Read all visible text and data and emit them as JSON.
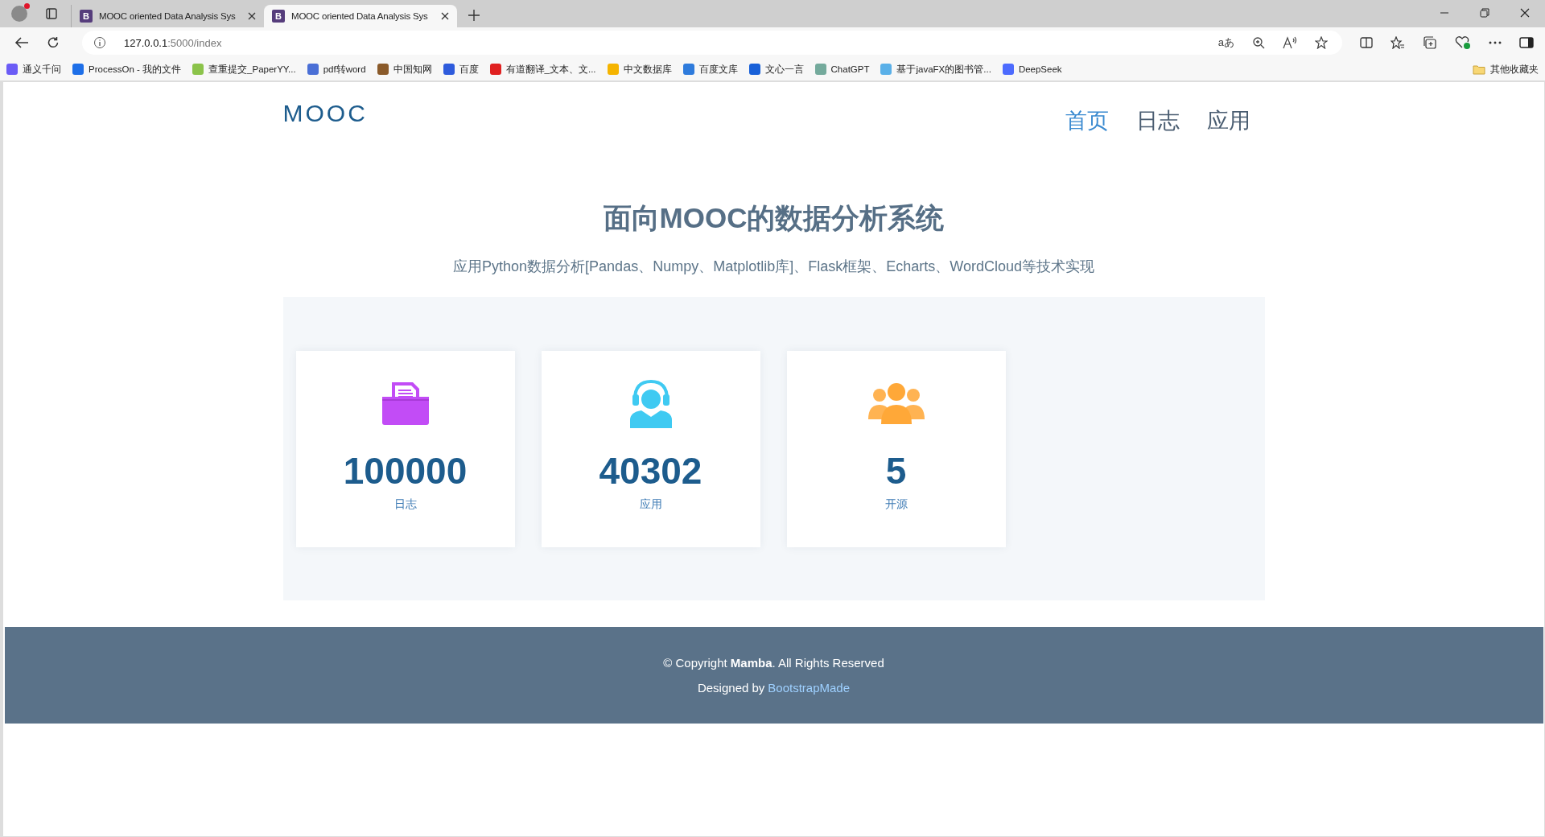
{
  "browser": {
    "tabs": [
      {
        "title": "MOOC oriented Data Analysis Sys",
        "icon_letter": "B",
        "selected": false
      },
      {
        "title": "MOOC oriented Data Analysis Sys",
        "icon_letter": "B",
        "selected": true
      }
    ],
    "address": {
      "host": "127.0.0.1",
      "rest": ":5000/index"
    },
    "translate_glyph": "aあ",
    "bookmarks": [
      {
        "label": "通义千问",
        "color": "#6b5cf6"
      },
      {
        "label": "ProcessOn - 我的文件",
        "color": "#1e6fe8"
      },
      {
        "label": "查重提交_PaperYY...",
        "color": "#8bc34a"
      },
      {
        "label": "pdf转word",
        "color": "#4a6fd6"
      },
      {
        "label": "中国知网",
        "color": "#8a5a2a"
      },
      {
        "label": "百度",
        "color": "#2e5bdc"
      },
      {
        "label": "有道翻译_文本、文...",
        "color": "#e02020"
      },
      {
        "label": "中文数据库",
        "color": "#f5b400"
      },
      {
        "label": "百度文库",
        "color": "#2e7bdc"
      },
      {
        "label": "文心一言",
        "color": "#1860d8"
      },
      {
        "label": "ChatGPT",
        "color": "#74aa9c"
      },
      {
        "label": "基于javaFX的图书管...",
        "color": "#5ab0e8"
      },
      {
        "label": "DeepSeek",
        "color": "#4d6bfe"
      }
    ],
    "other_bookmarks": "其他收藏夹"
  },
  "site": {
    "logo": "MOOC",
    "nav": [
      {
        "label": "首页",
        "selected": true
      },
      {
        "label": "日志",
        "selected": false
      },
      {
        "label": "应用",
        "selected": false
      }
    ],
    "title": "面向MOOC的数据分析系统",
    "subtitle": "应用Python数据分析[Pandas、Numpy、Matplotlib库]、Flask框架、Echarts、WordCloud等技术实现",
    "stats": [
      {
        "kind": "folder",
        "value": "100000",
        "label": "日志"
      },
      {
        "kind": "agent",
        "value": "40302",
        "label": "应用"
      },
      {
        "kind": "group",
        "value": "5",
        "label": "开源"
      }
    ],
    "footer": {
      "copyright": "© Copyright **Mamba**. All Rights Reserved",
      "designed_by": "Designed by",
      "link": "BootstrapMade"
    }
  }
}
